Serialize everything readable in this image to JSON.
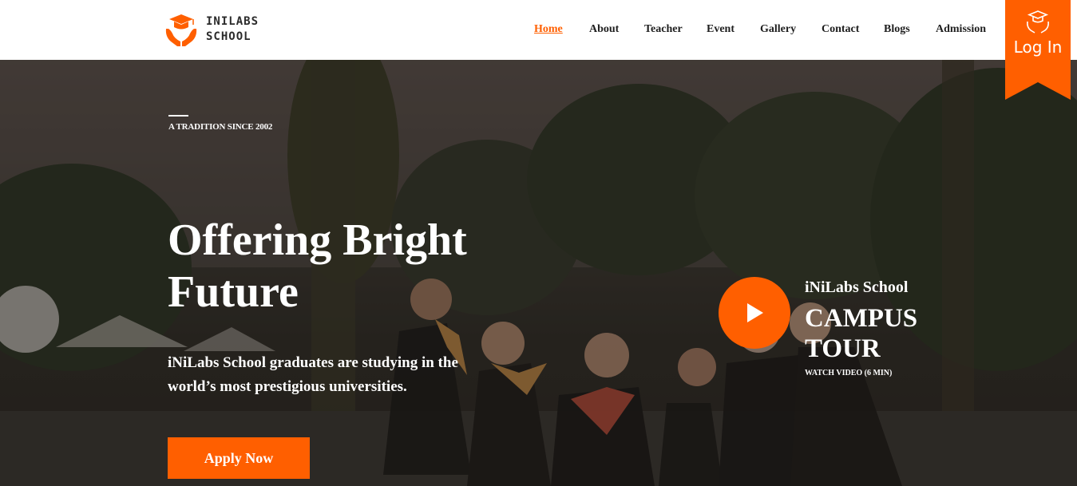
{
  "header": {
    "logo": {
      "line1": "INILABS",
      "line2": "SCHOOL"
    },
    "nav": [
      {
        "label": "Home",
        "active": true
      },
      {
        "label": "About",
        "active": false
      },
      {
        "label": "Teacher",
        "active": false
      },
      {
        "label": "Event",
        "active": false
      },
      {
        "label": "Gallery",
        "active": false
      },
      {
        "label": "Contact",
        "active": false
      },
      {
        "label": "Blogs",
        "active": false
      },
      {
        "label": "Admission",
        "active": false
      }
    ],
    "login": {
      "label": "Log In",
      "icon": "graduation-cap-hands-icon"
    }
  },
  "hero": {
    "kicker": "A TRADITION SINCE 2002",
    "title_line1": "Offering Bright",
    "title_line2": "Future",
    "subtitle": "iNiLabs School graduates are studying in the world’s most prestigious universities.",
    "apply_label": "Apply Now",
    "tour": {
      "school": "iNiLabs School",
      "title_line1": "CAMPUS",
      "title_line2": "TOUR",
      "watch": "WATCH VIDEO (6 MIN)",
      "play_icon": "play-icon"
    }
  },
  "colors": {
    "accent": "#ff5f00",
    "header_bg": "#ffffff",
    "text_dark": "#1e1e1e"
  }
}
